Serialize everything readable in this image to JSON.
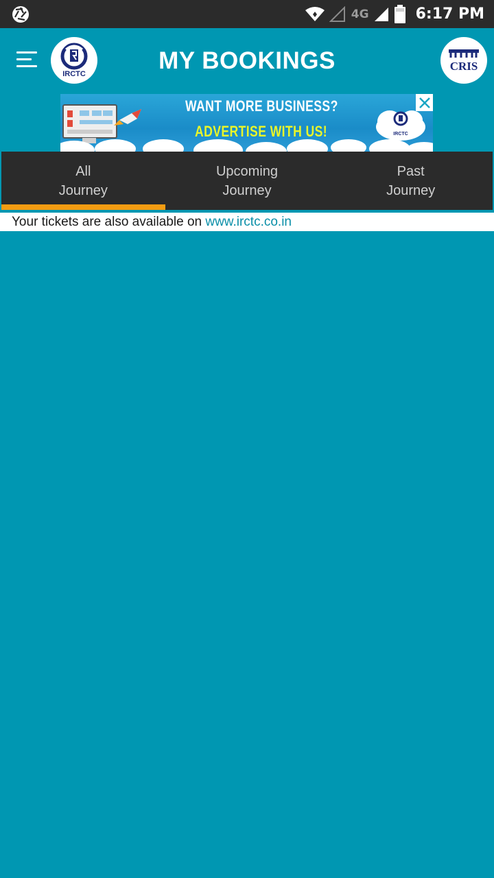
{
  "status_bar": {
    "time": "6:17 PM",
    "network": "4G",
    "icons": [
      "aperture-icon",
      "wifi-icon",
      "signal-empty-icon",
      "signal-icon",
      "battery-icon"
    ]
  },
  "app_bar": {
    "title": "MY BOOKINGS",
    "left_logo_text": "IRCTC",
    "right_logo_text": "CRIS",
    "menu_icon": "menu-icon"
  },
  "ad": {
    "line1": "WANT MORE BUSINESS?",
    "line2": "ADVERTISE WITH US!",
    "logo_text": "IRCTC",
    "colors": {
      "headline": "#ffffff",
      "highlight": "#e8f52a"
    }
  },
  "tabs": [
    {
      "line1": "All",
      "line2": "Journey",
      "selected": true
    },
    {
      "line1": "Upcoming",
      "line2": "Journey",
      "selected": false
    },
    {
      "line1": "Past",
      "line2": "Journey",
      "selected": false
    }
  ],
  "notice": {
    "text": "Your tickets are also available on ",
    "link": "www.irctc.co.in"
  },
  "colors": {
    "primary": "#0097b2",
    "tab_bar": "#2b2b2b",
    "tab_indicator": "#f39c12",
    "link": "#0a8fa8"
  }
}
